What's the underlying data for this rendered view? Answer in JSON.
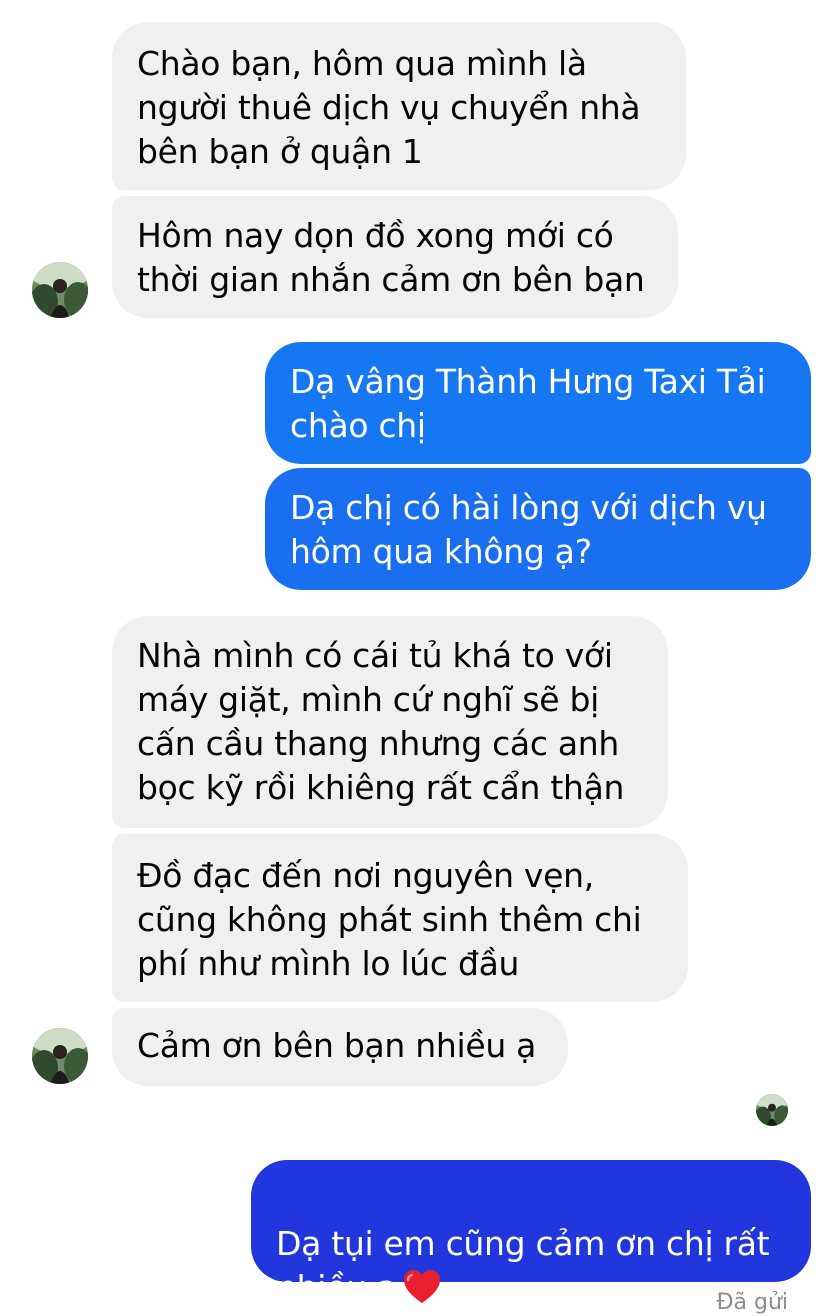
{
  "messages": [
    {
      "side": "incoming",
      "text": "Chào bạn, hôm qua mình là\nngười thuê dịch vụ chuyển nhà\nbên bạn ở quận 1"
    },
    {
      "side": "incoming",
      "text": "Hôm nay dọn đồ xong mới có\nthời gian nhắn cảm ơn bên bạn"
    },
    {
      "side": "outgoing",
      "text": "Dạ vâng Thành Hưng Taxi Tải\nchào chị"
    },
    {
      "side": "outgoing",
      "text": "Dạ chị có hài lòng với dịch vụ\nhôm qua không ạ?"
    },
    {
      "side": "incoming",
      "text": "Nhà mình có cái tủ khá to với\nmáy giặt, mình cứ nghĩ sẽ bị\ncấn cầu thang nhưng các anh\nbọc kỹ rồi khiêng rất cẩn thận"
    },
    {
      "side": "incoming",
      "text": "Đồ đạc đến nơi nguyên vẹn,\ncũng không phát sinh thêm chi\nphí như mình lo lúc đầu"
    },
    {
      "side": "incoming",
      "text": "Cảm ơn bên bạn nhiều ạ"
    },
    {
      "side": "outgoing",
      "text": "Dạ tụi em cũng cảm ơn chị rất\nnhiều ạ",
      "emoji": "heart-icon"
    }
  ],
  "status": "Đã gửi",
  "colors": {
    "incoming_bg": "#f0f0f3",
    "outgoing_top": "#1877f2",
    "outgoing_bottom": "#1a3ad6",
    "status_text": "#8a8d91",
    "heart": "#e8202e"
  }
}
